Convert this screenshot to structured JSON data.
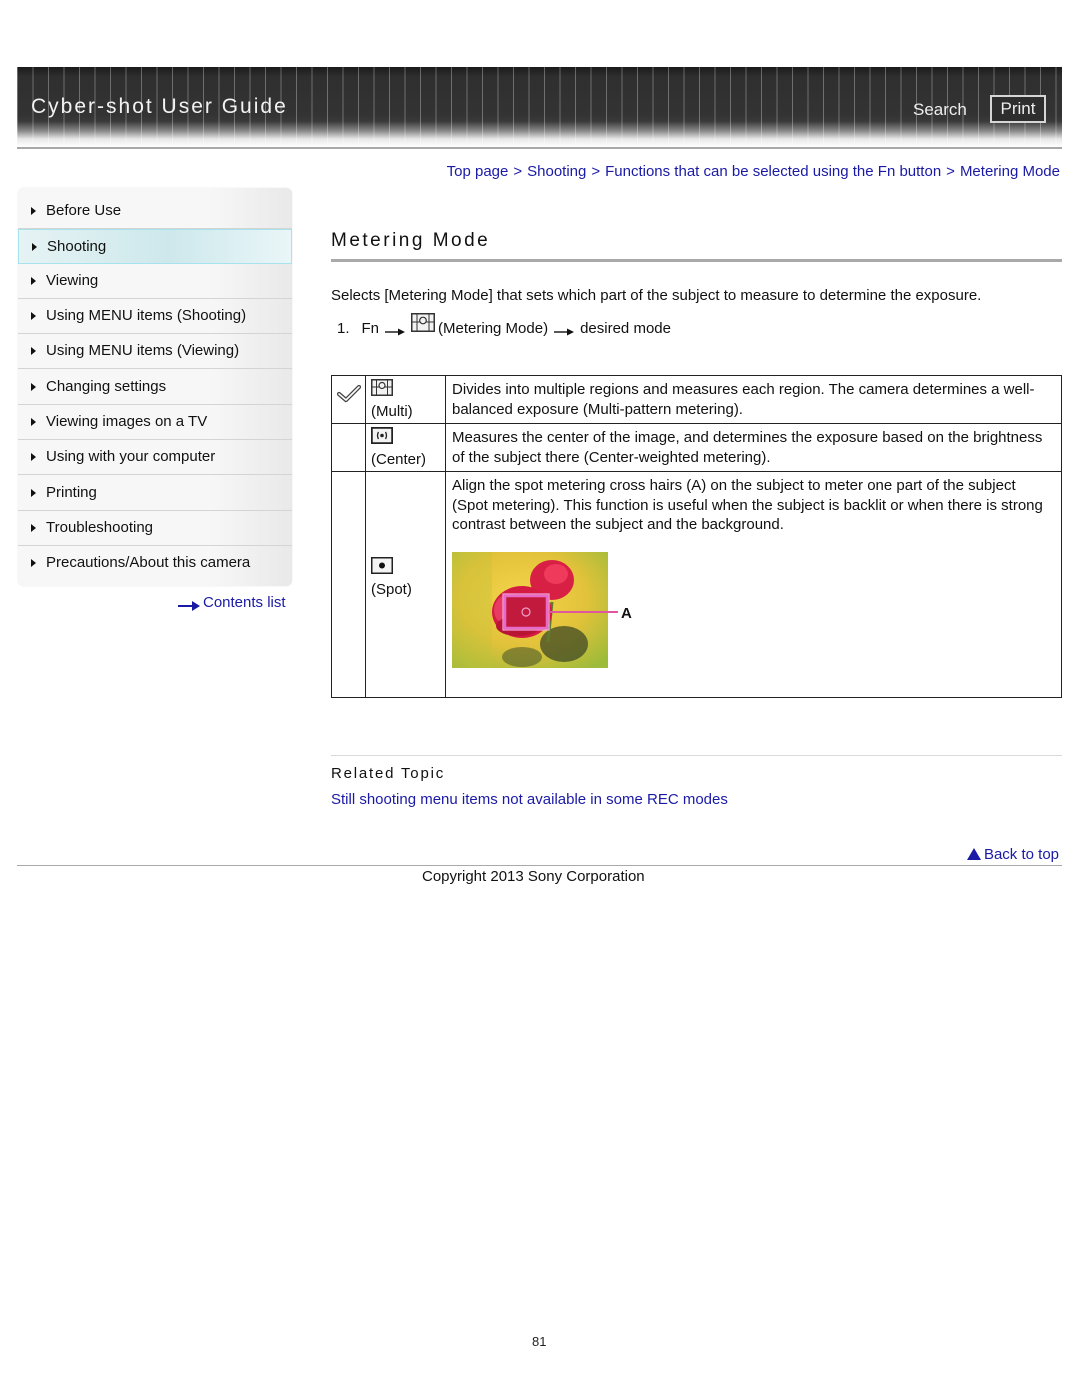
{
  "header": {
    "title": "Cyber-shot User Guide",
    "search_label": "Search",
    "print_label": "Print"
  },
  "sidebar": {
    "items": [
      {
        "label": "Before Use",
        "active": false
      },
      {
        "label": "Shooting",
        "active": true
      },
      {
        "label": "Viewing",
        "active": false
      },
      {
        "label": "Using MENU items (Shooting)",
        "active": false
      },
      {
        "label": "Using MENU items (Viewing)",
        "active": false
      },
      {
        "label": "Changing settings",
        "active": false
      },
      {
        "label": "Viewing images on a TV",
        "active": false
      },
      {
        "label": "Using with your computer",
        "active": false
      },
      {
        "label": "Printing",
        "active": false
      },
      {
        "label": "Troubleshooting",
        "active": false
      },
      {
        "label": "Precautions/About this camera",
        "active": false
      }
    ],
    "contents_list_label": "Contents list"
  },
  "breadcrumb": {
    "items": [
      "Top page",
      "Shooting",
      "Functions that can be selected using the Fn button",
      "Metering Mode"
    ],
    "separator": ">"
  },
  "main": {
    "title": "Metering Mode",
    "intro": "Selects [Metering Mode] that sets which part of the subject to measure to determine the exposure.",
    "step": {
      "number": "1.",
      "fn": "Fn",
      "menu_icon": "metering-mode-icon",
      "menu_label": "(Metering Mode)",
      "target": "desired mode"
    },
    "modes": [
      {
        "default": true,
        "icon": "multi-metering-icon",
        "name": "(Multi)",
        "description": "Divides into multiple regions and measures each region. The camera determines a well-balanced exposure (Multi-pattern metering)."
      },
      {
        "default": false,
        "icon": "center-metering-icon",
        "name": "(Center)",
        "description": "Measures the center of the image, and determines the exposure based on the brightness of the subject there (Center-weighted metering)."
      },
      {
        "default": false,
        "icon": "spot-metering-icon",
        "name": "(Spot)",
        "description": "Align the spot metering cross hairs (A) on the subject to meter one part of the subject (Spot metering). This function is useful when the subject is backlit or when there is strong contrast between the subject and the background.",
        "image_label": "A"
      }
    ]
  },
  "related": {
    "title": "Related Topic",
    "link": "Still shooting menu items not available in some REC modes"
  },
  "footer": {
    "back_to_top": "Back to top",
    "copyright": "Copyright 2013 Sony Corporation",
    "page_number": "81"
  },
  "colors": {
    "link": "#1a1aa6",
    "active_nav": "#cde8ec",
    "header_bg": "#333333"
  }
}
